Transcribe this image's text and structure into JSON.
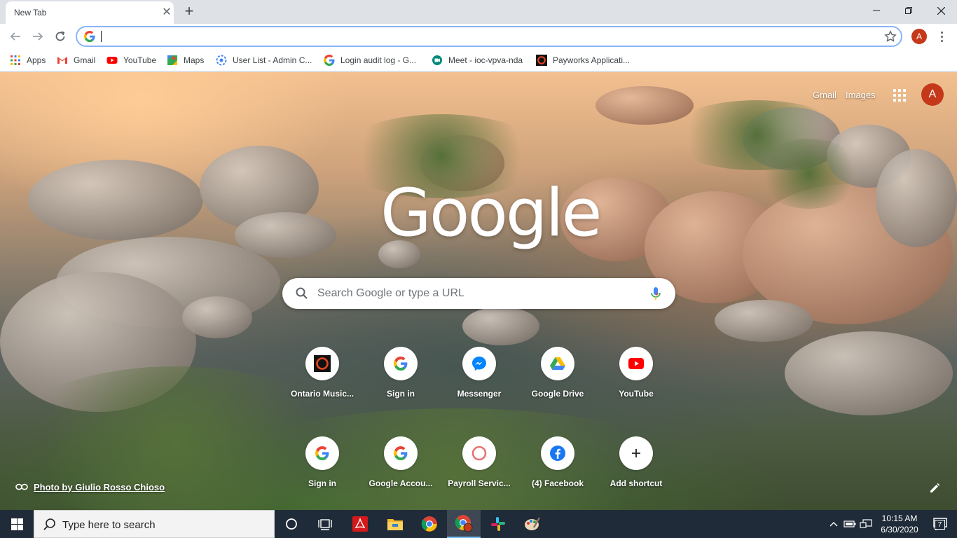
{
  "browser": {
    "tab_title": "New Tab",
    "tab_close_glyph": "✕",
    "new_tab_glyph": "+",
    "omnibox_value": "",
    "profile_initial": "A"
  },
  "bookmarks": [
    {
      "label": "Apps",
      "icon": "apps-grid-icon"
    },
    {
      "label": "Gmail",
      "icon": "gmail-icon"
    },
    {
      "label": "YouTube",
      "icon": "youtube-icon"
    },
    {
      "label": "Maps",
      "icon": "maps-icon"
    },
    {
      "label": "User List - Admin C...",
      "icon": "admin-icon"
    },
    {
      "label": "Login audit log - G...",
      "icon": "google-icon"
    },
    {
      "label": "Meet - ioc-vpva-nda",
      "icon": "meet-icon"
    },
    {
      "label": "Payworks Applicati...",
      "icon": "payworks-icon"
    }
  ],
  "ntp": {
    "gmail_link": "Gmail",
    "images_link": "Images",
    "profile_initial": "A",
    "logo_text": "Google",
    "search_placeholder": "Search Google or type a URL",
    "shortcuts": [
      {
        "label": "Ontario Music...",
        "icon": "ontario-music-icon"
      },
      {
        "label": "Sign in",
        "icon": "google-icon"
      },
      {
        "label": "Messenger",
        "icon": "messenger-icon"
      },
      {
        "label": "Google Drive",
        "icon": "google-drive-icon"
      },
      {
        "label": "YouTube",
        "icon": "youtube-icon"
      },
      {
        "label": "Sign in",
        "icon": "google-icon"
      },
      {
        "label": "Google Accou...",
        "icon": "google-icon"
      },
      {
        "label": "Payroll Servic...",
        "icon": "payroll-icon"
      },
      {
        "label": "(4) Facebook",
        "icon": "facebook-icon"
      },
      {
        "label": "Add shortcut",
        "icon": "plus-icon"
      }
    ],
    "attribution": "Photo by Giulio Rosso Chioso"
  },
  "taskbar": {
    "search_placeholder": "Type here to search",
    "time": "10:15 AM",
    "date": "6/30/2020",
    "notification_count": "7"
  },
  "colors": {
    "accent": "#1a73e8",
    "profile": "#c5381a",
    "taskbar": "#1f2b38"
  }
}
